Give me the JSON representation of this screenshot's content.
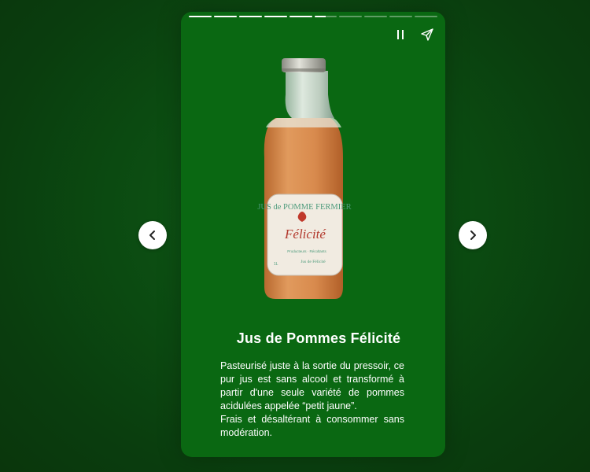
{
  "story": {
    "progress": {
      "segments": [
        1,
        1,
        1,
        1,
        1,
        0.5,
        0,
        0,
        0,
        0
      ]
    },
    "controls": {
      "pause_icon": "pause-icon",
      "share_icon": "send-icon"
    },
    "bottle_label": {
      "arc_text": "JUS de POMME FERMIER",
      "brand": "Félicité",
      "small_lines": [
        "Producteurs · Récoltants",
        "Jus de Félicité"
      ],
      "volume": "1L"
    },
    "title": "Jus de Pommes Félicité",
    "description": {
      "paragraph1": "Pasteurisé juste à la sortie du pressoir, ce pur jus est sans alcool et transformé à partir d'une seule variété de pommes acidulées appelée “petit jaune”.",
      "paragraph2": "Frais et désaltérant à consommer sans modération."
    }
  },
  "navigation": {
    "prev_icon": "chevron-left-icon",
    "next_icon": "chevron-right-icon"
  },
  "colors": {
    "background": "#0b4a11",
    "card": "#0a6812",
    "juice": "#d68a4f",
    "label": "#f1ebe1",
    "text": "#ffffff"
  }
}
